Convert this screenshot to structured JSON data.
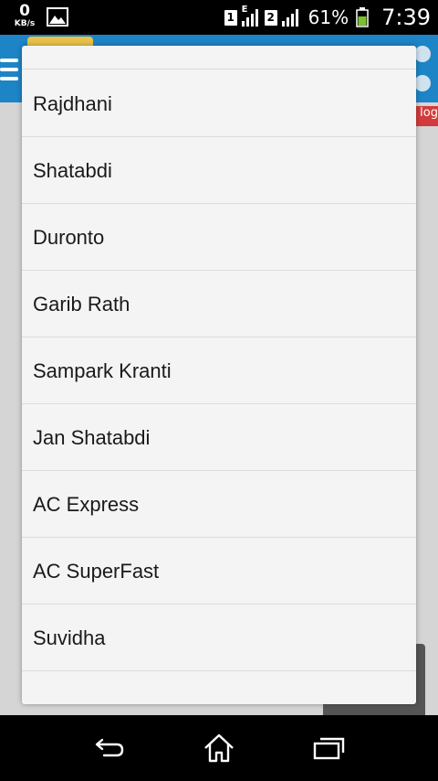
{
  "status_bar": {
    "speed_value": "0",
    "speed_unit": "KB/s",
    "sim1_label": "1",
    "sim1_network": "E",
    "sim2_label": "2",
    "battery_percent": "61%",
    "battery_level": 0.61,
    "time": "7:39"
  },
  "background_app": {
    "blog_label": "log"
  },
  "dialog": {
    "options": [
      "",
      "Rajdhani",
      "Shatabdi",
      "Duronto",
      "Garib Rath",
      "Sampark Kranti",
      "Jan Shatabdi",
      "AC Express",
      "AC SuperFast",
      "Suvidha",
      ""
    ]
  },
  "navbar": {
    "buttons": [
      "back-icon",
      "home-icon",
      "recent-apps-icon"
    ]
  },
  "colors": {
    "header_blue": "#1d84c6",
    "battery_green": "#7bbf2f",
    "dialog_bg": "#f4f4f4"
  }
}
